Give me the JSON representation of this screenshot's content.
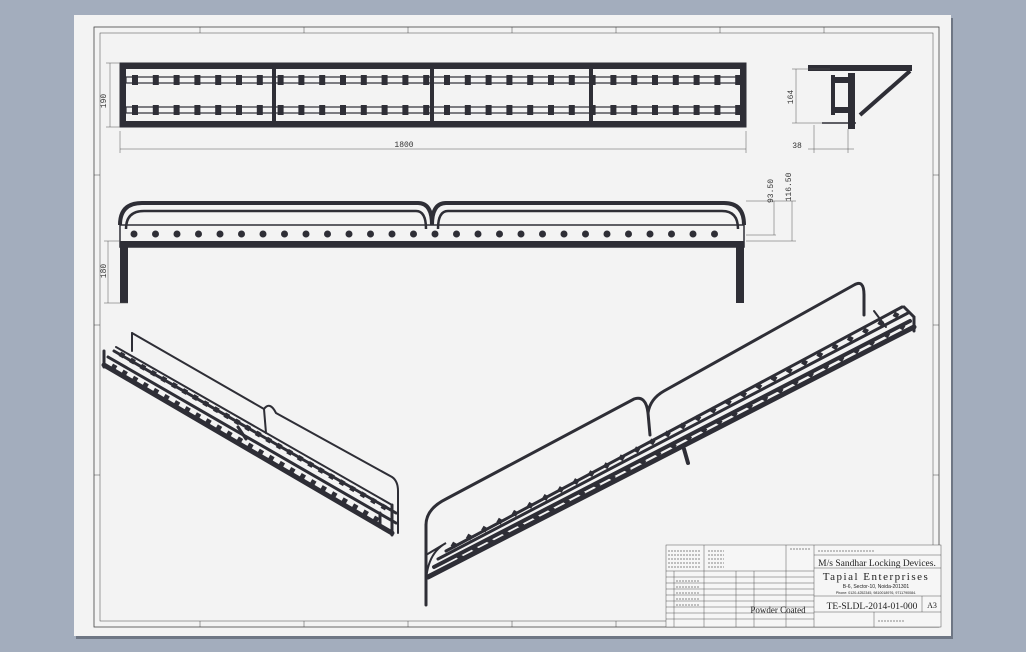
{
  "colors": {
    "background": "#a3adbd",
    "sheet": "#f3f3f3",
    "metal": "#2e2e36",
    "line": "#333333"
  },
  "dimensions": {
    "front_height": "190",
    "front_length": "1800",
    "side_height": "164",
    "side_depth": "38",
    "top_dim_1": "93.50",
    "top_dim_2": "116.50",
    "leg_height": "180"
  },
  "title_block": {
    "client": "M/s Sandhar Locking Devices.",
    "company": "Tapial Enterprises",
    "address": "B-6, Sector-10, Noida-201301",
    "contact": "Phone: 0120-4252345, 9810018976, 9711790084.",
    "finish": "Powder Coated",
    "drawing_no": "TE-SLDL-2014-01-000",
    "sheet_size": "A3"
  }
}
